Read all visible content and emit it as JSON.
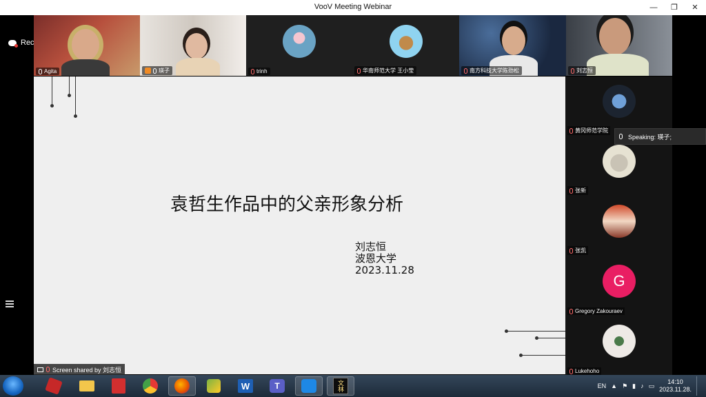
{
  "window": {
    "title": "VooV Meeting Webinar",
    "minimize": "—",
    "maximize": "❐",
    "close": "✕"
  },
  "recording": {
    "label": "Recording"
  },
  "participants_top": [
    {
      "name": "Agita"
    },
    {
      "name": "瑛子"
    },
    {
      "name": "trinh"
    },
    {
      "name": "华南师范大学 王小莹"
    },
    {
      "name": "南方科技大学陈劲松"
    },
    {
      "name": "刘志恒"
    }
  ],
  "slide": {
    "title": "袁哲生作品中的父亲形象分析",
    "author": "刘志恒",
    "university": "波恩大学",
    "date": "2023.11.28"
  },
  "participants_side": [
    {
      "name": "黄冈师范学院"
    },
    {
      "name": "张新"
    },
    {
      "name": "张凯"
    },
    {
      "name": "Gregory Zakouraev",
      "initial": "G"
    },
    {
      "name": "Lukehoho"
    }
  ],
  "speaking": {
    "label": "Speaking: 瑛子;"
  },
  "screen_share": {
    "label": "Screen shared by 刘志恒"
  },
  "taskbar": {
    "apps": [
      "folder",
      "pdf-reader",
      "chrome",
      "firefox",
      "sync",
      "word",
      "teams",
      "voov-meeting",
      "wenlin"
    ],
    "wenlin_label": "文林",
    "word_label": "W",
    "teams_label": "T",
    "tray_lang": "EN",
    "time": "14:10",
    "date": "2023.11.28."
  },
  "colors": {
    "avatar_g": "#e91e63",
    "slide_bg": "#efefef"
  }
}
